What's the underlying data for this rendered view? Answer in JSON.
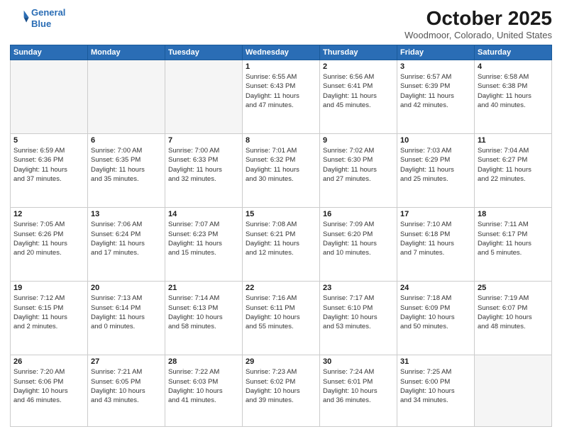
{
  "header": {
    "logo_line1": "General",
    "logo_line2": "Blue",
    "month_title": "October 2025",
    "location": "Woodmoor, Colorado, United States"
  },
  "days_of_week": [
    "Sunday",
    "Monday",
    "Tuesday",
    "Wednesday",
    "Thursday",
    "Friday",
    "Saturday"
  ],
  "weeks": [
    [
      {
        "day": "",
        "info": ""
      },
      {
        "day": "",
        "info": ""
      },
      {
        "day": "",
        "info": ""
      },
      {
        "day": "1",
        "info": "Sunrise: 6:55 AM\nSunset: 6:43 PM\nDaylight: 11 hours\nand 47 minutes."
      },
      {
        "day": "2",
        "info": "Sunrise: 6:56 AM\nSunset: 6:41 PM\nDaylight: 11 hours\nand 45 minutes."
      },
      {
        "day": "3",
        "info": "Sunrise: 6:57 AM\nSunset: 6:39 PM\nDaylight: 11 hours\nand 42 minutes."
      },
      {
        "day": "4",
        "info": "Sunrise: 6:58 AM\nSunset: 6:38 PM\nDaylight: 11 hours\nand 40 minutes."
      }
    ],
    [
      {
        "day": "5",
        "info": "Sunrise: 6:59 AM\nSunset: 6:36 PM\nDaylight: 11 hours\nand 37 minutes."
      },
      {
        "day": "6",
        "info": "Sunrise: 7:00 AM\nSunset: 6:35 PM\nDaylight: 11 hours\nand 35 minutes."
      },
      {
        "day": "7",
        "info": "Sunrise: 7:00 AM\nSunset: 6:33 PM\nDaylight: 11 hours\nand 32 minutes."
      },
      {
        "day": "8",
        "info": "Sunrise: 7:01 AM\nSunset: 6:32 PM\nDaylight: 11 hours\nand 30 minutes."
      },
      {
        "day": "9",
        "info": "Sunrise: 7:02 AM\nSunset: 6:30 PM\nDaylight: 11 hours\nand 27 minutes."
      },
      {
        "day": "10",
        "info": "Sunrise: 7:03 AM\nSunset: 6:29 PM\nDaylight: 11 hours\nand 25 minutes."
      },
      {
        "day": "11",
        "info": "Sunrise: 7:04 AM\nSunset: 6:27 PM\nDaylight: 11 hours\nand 22 minutes."
      }
    ],
    [
      {
        "day": "12",
        "info": "Sunrise: 7:05 AM\nSunset: 6:26 PM\nDaylight: 11 hours\nand 20 minutes."
      },
      {
        "day": "13",
        "info": "Sunrise: 7:06 AM\nSunset: 6:24 PM\nDaylight: 11 hours\nand 17 minutes."
      },
      {
        "day": "14",
        "info": "Sunrise: 7:07 AM\nSunset: 6:23 PM\nDaylight: 11 hours\nand 15 minutes."
      },
      {
        "day": "15",
        "info": "Sunrise: 7:08 AM\nSunset: 6:21 PM\nDaylight: 11 hours\nand 12 minutes."
      },
      {
        "day": "16",
        "info": "Sunrise: 7:09 AM\nSunset: 6:20 PM\nDaylight: 11 hours\nand 10 minutes."
      },
      {
        "day": "17",
        "info": "Sunrise: 7:10 AM\nSunset: 6:18 PM\nDaylight: 11 hours\nand 7 minutes."
      },
      {
        "day": "18",
        "info": "Sunrise: 7:11 AM\nSunset: 6:17 PM\nDaylight: 11 hours\nand 5 minutes."
      }
    ],
    [
      {
        "day": "19",
        "info": "Sunrise: 7:12 AM\nSunset: 6:15 PM\nDaylight: 11 hours\nand 2 minutes."
      },
      {
        "day": "20",
        "info": "Sunrise: 7:13 AM\nSunset: 6:14 PM\nDaylight: 11 hours\nand 0 minutes."
      },
      {
        "day": "21",
        "info": "Sunrise: 7:14 AM\nSunset: 6:13 PM\nDaylight: 10 hours\nand 58 minutes."
      },
      {
        "day": "22",
        "info": "Sunrise: 7:16 AM\nSunset: 6:11 PM\nDaylight: 10 hours\nand 55 minutes."
      },
      {
        "day": "23",
        "info": "Sunrise: 7:17 AM\nSunset: 6:10 PM\nDaylight: 10 hours\nand 53 minutes."
      },
      {
        "day": "24",
        "info": "Sunrise: 7:18 AM\nSunset: 6:09 PM\nDaylight: 10 hours\nand 50 minutes."
      },
      {
        "day": "25",
        "info": "Sunrise: 7:19 AM\nSunset: 6:07 PM\nDaylight: 10 hours\nand 48 minutes."
      }
    ],
    [
      {
        "day": "26",
        "info": "Sunrise: 7:20 AM\nSunset: 6:06 PM\nDaylight: 10 hours\nand 46 minutes."
      },
      {
        "day": "27",
        "info": "Sunrise: 7:21 AM\nSunset: 6:05 PM\nDaylight: 10 hours\nand 43 minutes."
      },
      {
        "day": "28",
        "info": "Sunrise: 7:22 AM\nSunset: 6:03 PM\nDaylight: 10 hours\nand 41 minutes."
      },
      {
        "day": "29",
        "info": "Sunrise: 7:23 AM\nSunset: 6:02 PM\nDaylight: 10 hours\nand 39 minutes."
      },
      {
        "day": "30",
        "info": "Sunrise: 7:24 AM\nSunset: 6:01 PM\nDaylight: 10 hours\nand 36 minutes."
      },
      {
        "day": "31",
        "info": "Sunrise: 7:25 AM\nSunset: 6:00 PM\nDaylight: 10 hours\nand 34 minutes."
      },
      {
        "day": "",
        "info": ""
      }
    ]
  ]
}
